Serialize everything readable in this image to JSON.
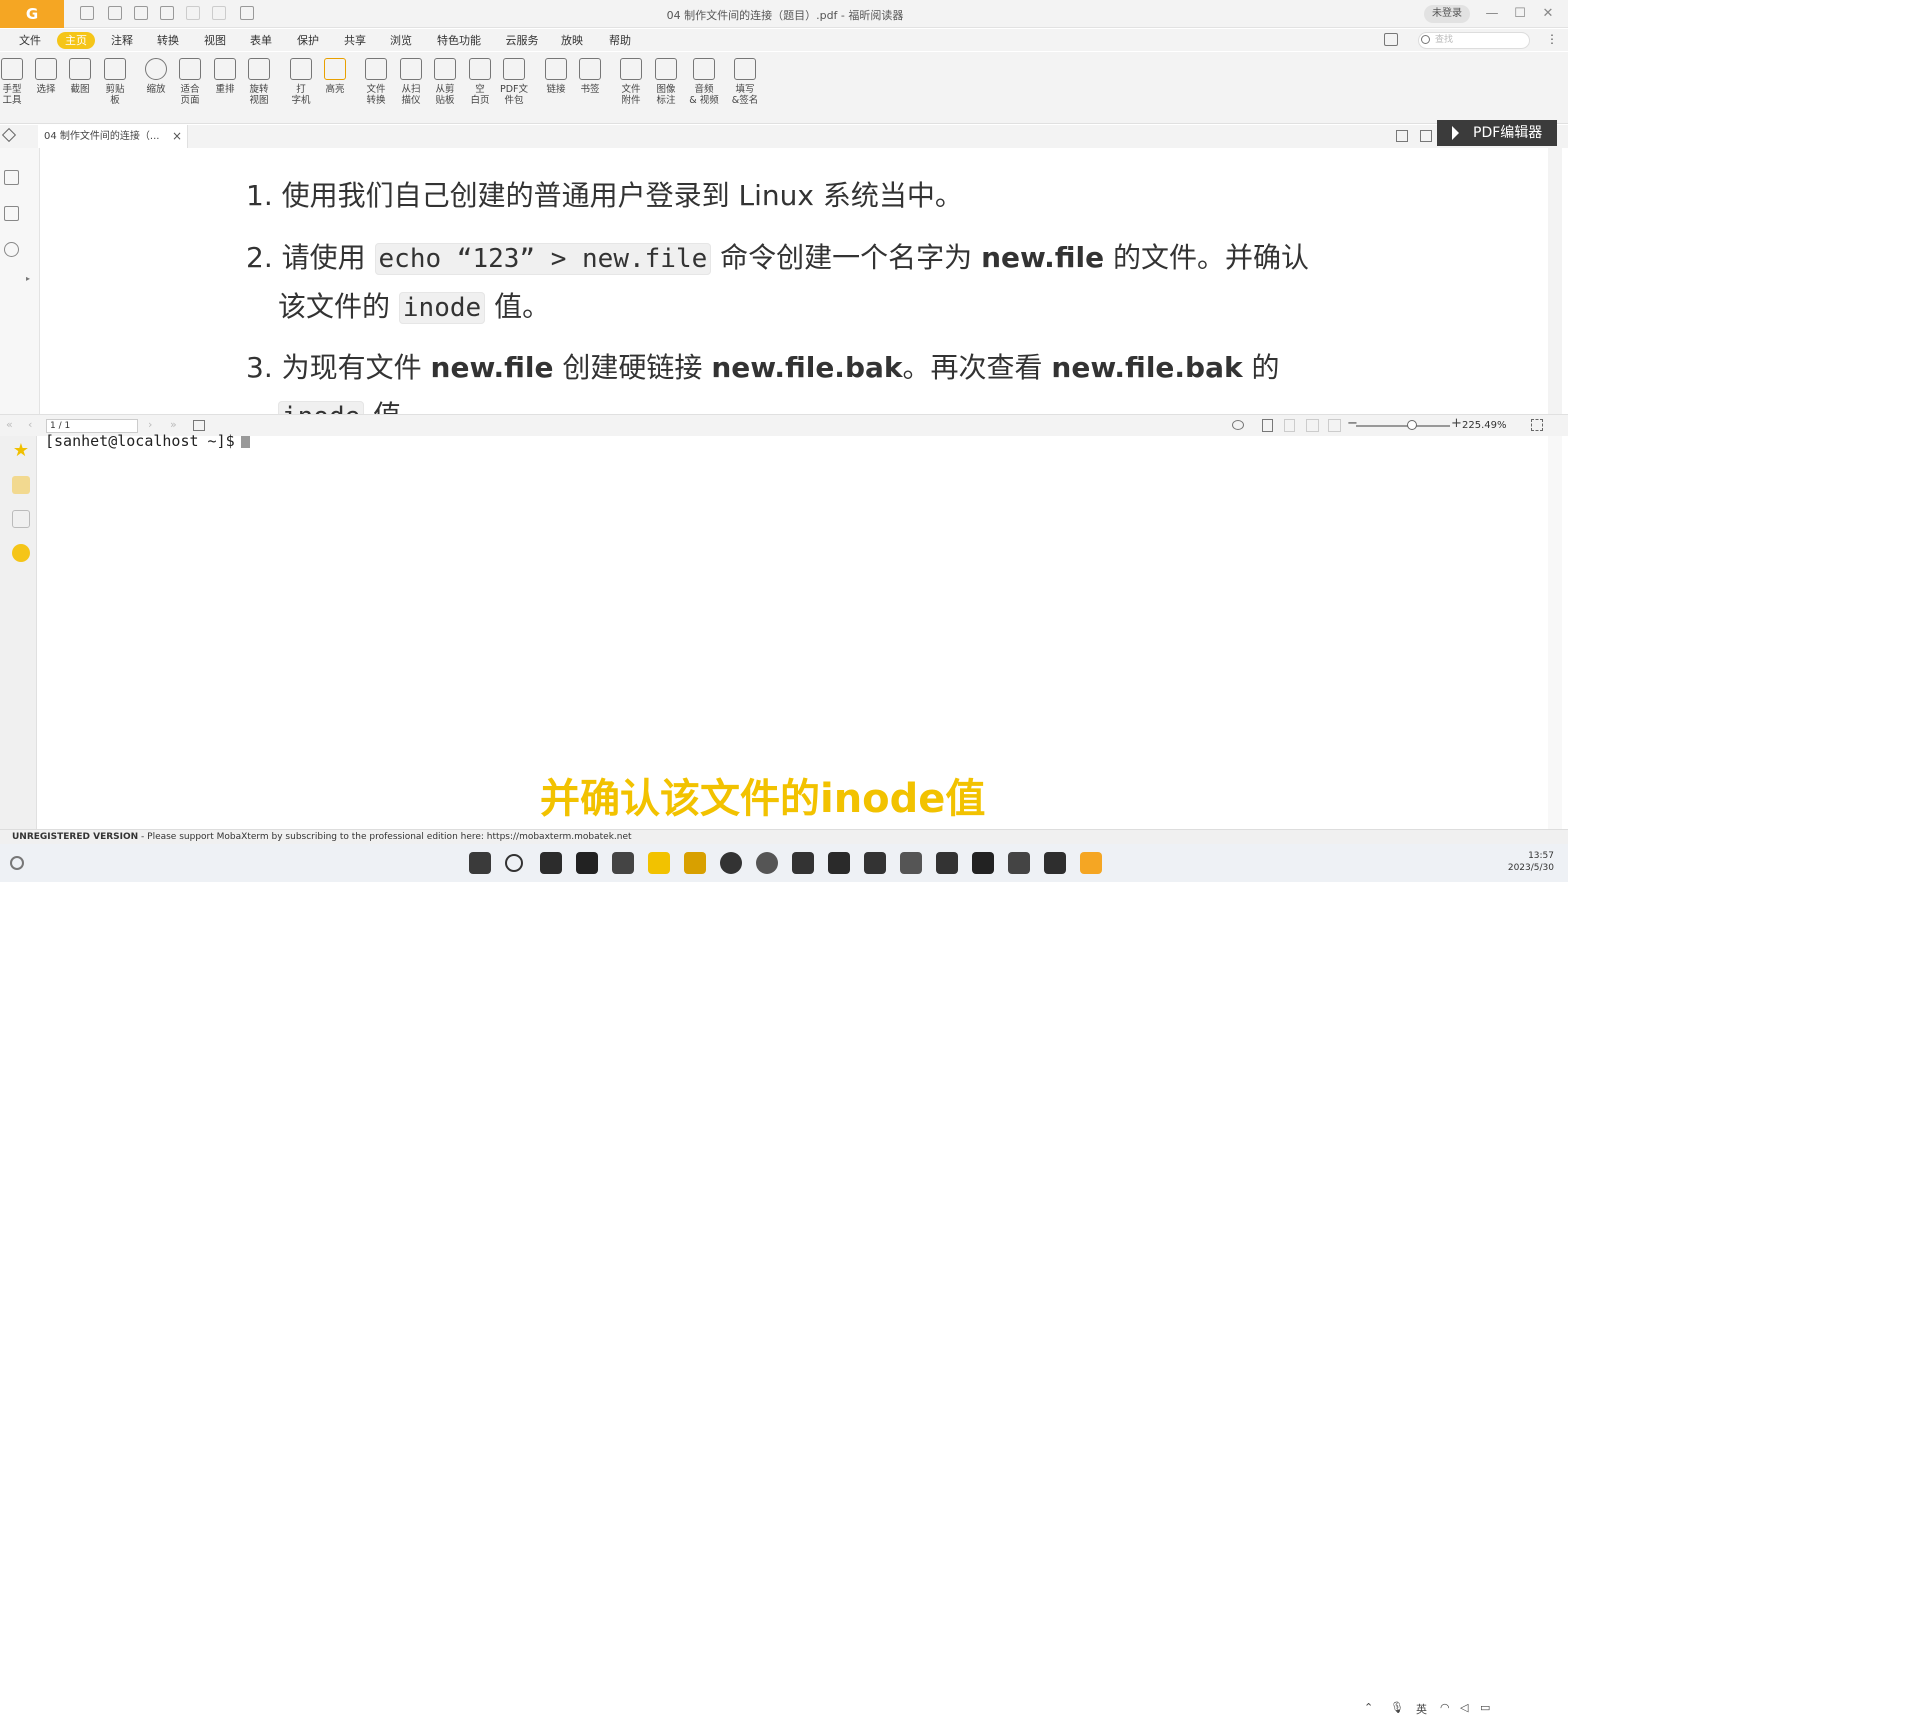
{
  "window": {
    "title": "04 制作文件间的连接（题目）.pdf - 福昕阅读器",
    "login_label": "未登录",
    "app_logo": "G"
  },
  "menu": {
    "items": [
      "文件",
      "主页",
      "注释",
      "转换",
      "视图",
      "表单",
      "保护",
      "共享",
      "浏览",
      "特色功能",
      "云服务",
      "放映",
      "帮助"
    ],
    "search_placeholder": "查找"
  },
  "ribbon": {
    "tools": [
      {
        "label": "手型\n工具",
        "icon": "hand-icon"
      },
      {
        "label": "选择",
        "icon": "select-text-icon"
      },
      {
        "label": "截图",
        "icon": "screenshot-icon"
      },
      {
        "label": "剪贴\n板",
        "icon": "clipboard-icon"
      },
      {
        "label": "缩放",
        "icon": "zoom-icon"
      },
      {
        "label": "适合\n页面",
        "icon": "fit-page-icon"
      },
      {
        "label": "重排",
        "icon": "reflow-icon"
      },
      {
        "label": "旋转\n视图",
        "icon": "rotate-icon"
      },
      {
        "label": "打\n字机",
        "icon": "typewriter-icon"
      },
      {
        "label": "高亮",
        "icon": "highlight-icon"
      },
      {
        "label": "文件\n转换",
        "icon": "file-convert-icon"
      },
      {
        "label": "从扫\n描仪",
        "icon": "scanner-icon"
      },
      {
        "label": "从剪\n贴板",
        "icon": "from-clipboard-icon"
      },
      {
        "label": "空\n白页",
        "icon": "blank-page-icon"
      },
      {
        "label": "PDF文\n件包",
        "icon": "pdf-package-icon"
      },
      {
        "label": "链接",
        "icon": "link-icon"
      },
      {
        "label": "书签",
        "icon": "bookmark-icon"
      },
      {
        "label": "文件\n附件",
        "icon": "attachment-icon"
      },
      {
        "label": "图像\n标注",
        "icon": "image-annotation-icon"
      },
      {
        "label": "音频\n& 视频",
        "icon": "media-icon"
      },
      {
        "label": "填写\n&签名",
        "icon": "sign-icon"
      }
    ]
  },
  "tab": {
    "label": "04 制作文件间的连接（...",
    "close": "×"
  },
  "pdf_editor_label": "PDF编辑器",
  "document": {
    "item1": "1. 使用我们自己创建的普通用户登录到 Linux 系统当中。",
    "item2_prefix": "2. 请使用 ",
    "item2_code": "echo “123” > new.file",
    "item2_mid": " 命令创建一个名字为 ",
    "item2_bold": "new.file",
    "item2_suffix": " 的文件。并确认",
    "item2_line2_prefix": "该文件的 ",
    "item2_line2_code": "inode",
    "item2_line2_suffix": " 值。",
    "item3_prefix": "3. 为现有文件 ",
    "item3_bold1": "new.file",
    "item3_mid": " 创建硬链接 ",
    "item3_bold2": "new.file.bak",
    "item3_mid2": "。再次查看 ",
    "item3_bold3": "new.file.bak",
    "item3_suffix": " 的",
    "item3_line2_code": "inode",
    "item3_line2_suffix": " 值"
  },
  "status": {
    "page": "1 / 1",
    "zoom": "225.49%",
    "zoom_fraction": 0.6
  },
  "terminal": {
    "prompt": "[sanhet@localhost ~]$"
  },
  "subtitle": "并确认该文件的inode值",
  "moba_status": {
    "bold": "UNREGISTERED VERSION",
    "text": " -  Please support MobaXterm by subscribing to the professional edition here:  https://mobaxterm.mobatek.net"
  },
  "taskbar": {
    "time": "13:57",
    "date": "2023/5/30",
    "ime": "英"
  },
  "colors": {
    "accent": "#f5a623",
    "home_tab": "#f5c518",
    "subtitle": "#f2c200",
    "editor_button": "#3b3b3b"
  }
}
